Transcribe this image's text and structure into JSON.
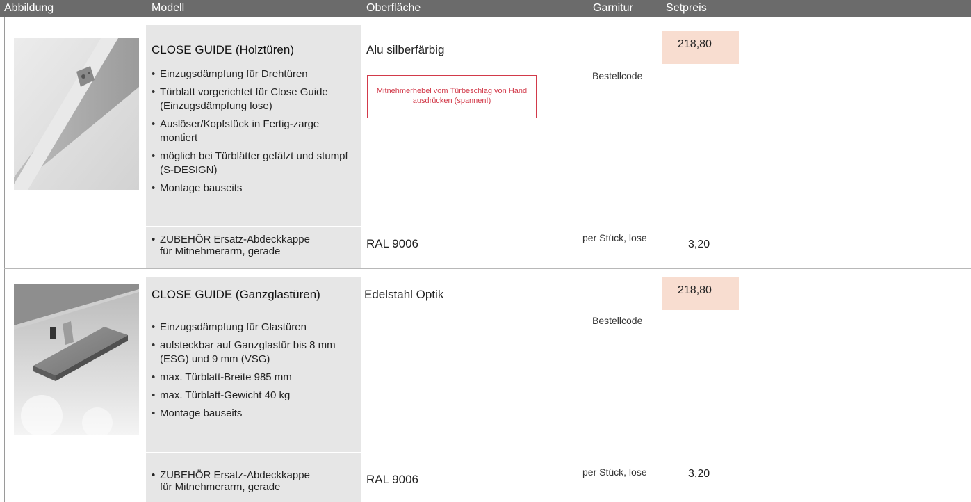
{
  "header": {
    "columns": [
      "Abbildung",
      "Modell",
      "Oberfläche",
      "Garnitur",
      "Setpreis"
    ]
  },
  "products": [
    {
      "image_alt": "Türbeschlag Holztür Foto",
      "title": "CLOSE GUIDE (Holztüren)",
      "bullets": [
        "Einzugsdämpfung für Drehtüren",
        "Türblatt vorgerichtet für Close Guide (Einzugsdämpfung lose)",
        "Auslöser/Kopfstück in Fertig-zarge montiert",
        "möglich bei Türblätter gefälzt und stumpf (S-DESIGN)",
        "Montage bauseits"
      ],
      "surface": "Alu silberfärbig",
      "notice": "Mitnehmerhebel vom Türbeschlag von Hand ausdrücken (spannen!)",
      "order_code_label": "Bestellcode",
      "price": "218,80",
      "accessory": {
        "line1": "ZUBEHÖR Ersatz-Abdeckkappe",
        "line2": "für Mitnehmerarm, gerade",
        "surface": "RAL 9006",
        "unit": "per Stück, lose",
        "price": "3,20"
      }
    },
    {
      "image_alt": "Ganzglastür Beschlag Foto",
      "title": "CLOSE GUIDE (Ganzglastüren)",
      "bullets": [
        "Einzugsdämpfung für Glastüren",
        "aufsteckbar auf Ganzglastür bis 8 mm (ESG) und 9 mm (VSG)",
        "max. Türblatt-Breite 985 mm",
        "max. Türblatt-Gewicht 40 kg",
        "Montage bauseits"
      ],
      "surface": "Edelstahl Optik",
      "order_code_label": "Bestellcode",
      "price": "218,80",
      "accessory": {
        "line1": "ZUBEHÖR Ersatz-Abdeckkappe",
        "line2": "für Mitnehmerarm, gerade",
        "surface": "RAL 9006",
        "unit": "per Stück, lose",
        "price": "3,20"
      }
    }
  ],
  "colors": {
    "header_bg": "#6b6b6b",
    "gray_column": "#e6e6e6",
    "price_highlight": "#f8ddd0",
    "notice_red": "#d23a4a"
  }
}
